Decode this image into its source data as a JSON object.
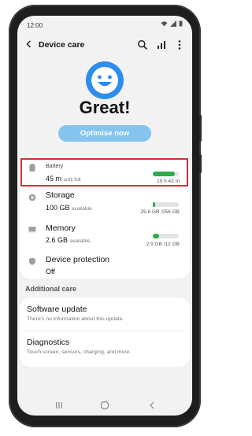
{
  "status_bar": {
    "time": "12:00"
  },
  "app_bar": {
    "title": "Device care",
    "back_icon": "chevron-left-icon",
    "search_icon": "search-icon",
    "stats_icon": "bar-chart-icon",
    "more_icon": "more-vertical-icon"
  },
  "summary": {
    "face_icon": "smiley-face-icon",
    "status": "Great!",
    "optimise_label": "Optimise now"
  },
  "rows": {
    "battery": {
      "title": "Battery",
      "value": "45 m",
      "value_suffix": "until full",
      "right": "15 h 43 m",
      "fill": 0.85
    },
    "storage": {
      "title": "Storage",
      "value": "100 GB",
      "value_suffix": "available",
      "right": "25.6 GB /256 GB",
      "fill": 0.1
    },
    "memory": {
      "title": "Memory",
      "value": "2.6 GB",
      "value_suffix": "available",
      "right": "2.9 GB /12 GB",
      "fill": 0.24
    },
    "protection": {
      "title": "Device protection",
      "value": "Off"
    }
  },
  "additional": {
    "heading": "Additional care",
    "software_title": "Software update",
    "software_desc": "There's no information about this update.",
    "diag_title": "Diagnostics",
    "diag_desc": "Touch screen, sensors, charging, and more."
  },
  "nav": {
    "recents": "recents-icon",
    "home": "home-icon",
    "back": "back-icon"
  },
  "colors": {
    "accent": "#2d8cf0",
    "button": "#84c4ef",
    "bar_fill": "#2cad4c",
    "highlight": "#d1323b"
  }
}
